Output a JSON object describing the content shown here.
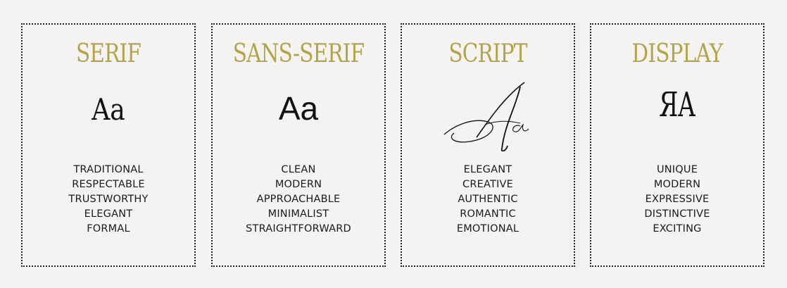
{
  "cards": [
    {
      "title": "SERIF",
      "sample": "Aa",
      "traits": [
        "TRADITIONAL",
        "RESPECTABLE",
        "TRUSTWORTHY",
        "ELEGANT",
        "FORMAL"
      ]
    },
    {
      "title": "SANS-SERIF",
      "sample": "Aa",
      "traits": [
        "CLEAN",
        "MODERN",
        "APPROACHABLE",
        "MINIMALIST",
        "STRAIGHTFORWARD"
      ]
    },
    {
      "title": "SCRIPT",
      "sample": "Aa",
      "traits": [
        "ELEGANT",
        "CREATIVE",
        "AUTHENTIC",
        "ROMANTIC",
        "EMOTIONAL"
      ]
    },
    {
      "title": "DISPLAY",
      "sample": "ЯA",
      "traits": [
        "UNIQUE",
        "MODERN",
        "EXPRESSIVE",
        "DISTINCTIVE",
        "EXCITING"
      ]
    }
  ],
  "colors": {
    "background": "#f4f3f1",
    "title": "#b2a44b",
    "text": "#1a1a1a",
    "border": "#222222"
  }
}
